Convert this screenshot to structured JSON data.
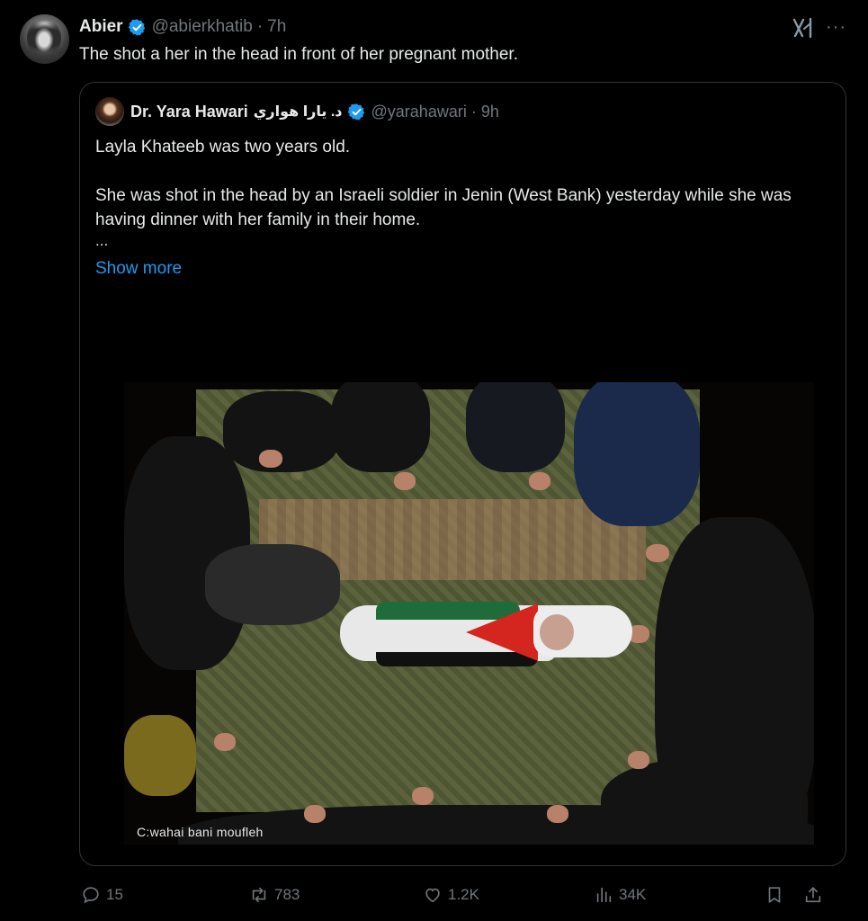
{
  "tweet": {
    "author_name": "Abier",
    "author_handle": "@abierkhatib",
    "separator": "·",
    "time": "7h",
    "text": "The shot a her in the head in front of her pregnant mother."
  },
  "quote": {
    "author_name": "Dr. Yara Hawari",
    "author_name_ar": "د. يارا هواري",
    "author_handle": "@yarahawari",
    "separator": "·",
    "time": "9h",
    "paragraph1": "Layla Khateeb was two years old.",
    "paragraph2": "She was shot in the head by an Israeli soldier in Jenin (West Bank) yesterday while she was having dinner with her family in their home.",
    "ellipsis": "...",
    "show_more": "Show more",
    "image_credit": "C:wahai bani moufleh"
  },
  "actions": {
    "replies": "15",
    "reposts": "783",
    "likes": "1.2K",
    "views": "34K"
  },
  "icons": {
    "verified": "verified-badge-icon",
    "grok": "grok-icon",
    "more": "more-icon",
    "reply": "reply-icon",
    "repost": "repost-icon",
    "like": "like-icon",
    "views": "views-icon",
    "bookmark": "bookmark-icon",
    "share": "share-icon"
  },
  "colors": {
    "background": "#000000",
    "text": "#e7e9ea",
    "secondary": "#71767b",
    "accent": "#1d9bf0",
    "border": "#2f3336"
  }
}
